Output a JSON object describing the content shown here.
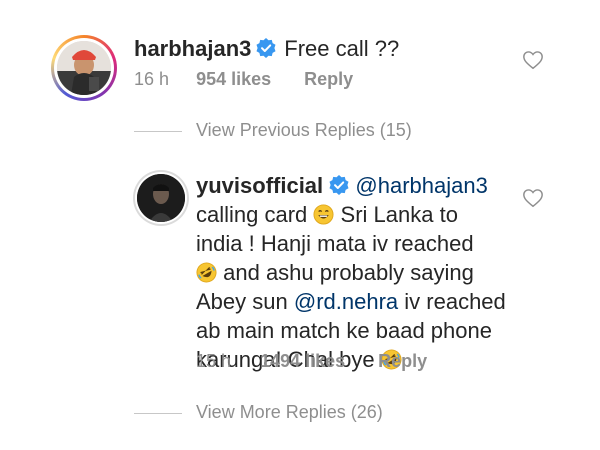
{
  "comment1": {
    "username": "harbhajan3",
    "text": "Free call ??",
    "time": "16 h",
    "likes": "954 likes",
    "reply": "Reply",
    "icons": {
      "verified": "verified-badge-icon",
      "like": "heart-icon"
    }
  },
  "view_previous": "View Previous Replies (15)",
  "comment2": {
    "username": "yuvisofficial",
    "mention1": "@harbhajan3",
    "line1_a": "calling card",
    "line1_b": "Sri Lanka to",
    "line2": "india ! Hanji mata iv reached",
    "line3": "and ashu probably saying",
    "line4_a": "Abey sun",
    "mention2": "@rd.nehra",
    "line4_b": "iv reached",
    "line5": "ab main match ke baad phone",
    "line6": "karunga! Chal bye",
    "time": "15 h",
    "likes": "1494 likes",
    "reply": "Reply",
    "icons": {
      "verified": "verified-badge-icon",
      "like": "heart-icon",
      "emojis": [
        "grinning-face-emoji",
        "rofl-emoji",
        "rofl-emoji"
      ]
    }
  },
  "view_more": "View More Replies (26)",
  "colors": {
    "verified": "#3897f0",
    "meta": "#8e8e8e",
    "mention": "#003569",
    "emoji": "#f7c531"
  }
}
